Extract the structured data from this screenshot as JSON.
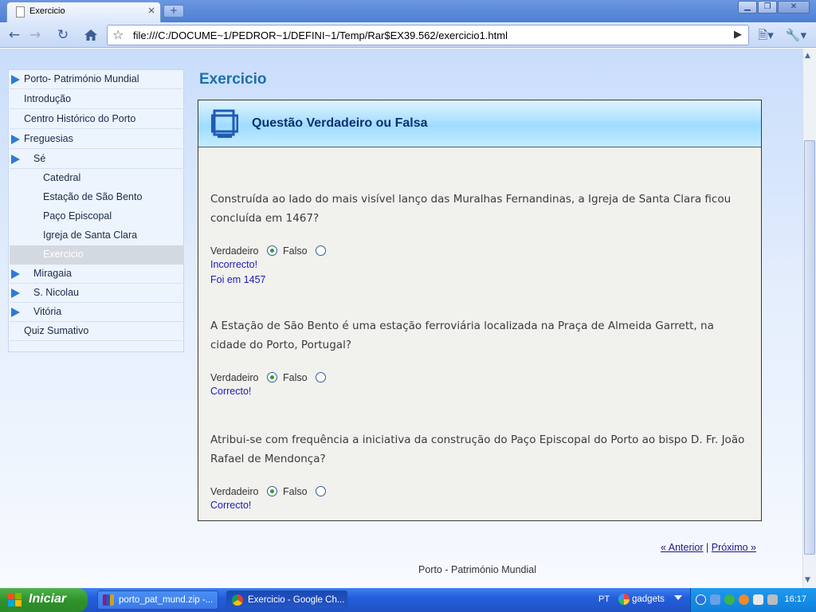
{
  "browser": {
    "tab_title": "Exercicio",
    "tab_close": "×",
    "new_tab": "+",
    "url": "file:///C:/DOCUME~1/PEDROR~1/DEFINI~1/Temp/Rar$EX39.562/exercicio1.html",
    "window_controls": {
      "minimize": "▁",
      "maximize": "❐",
      "close": "✕"
    }
  },
  "sidebar": {
    "items": [
      {
        "label": "Porto- Património Mundial",
        "arrow": true,
        "level": 0
      },
      {
        "label": "Introdução",
        "arrow": false,
        "level": 0
      },
      {
        "label": "Centro Histórico do Porto",
        "arrow": false,
        "level": 0
      },
      {
        "label": "Freguesias",
        "arrow": true,
        "level": 0
      },
      {
        "label": "Sé",
        "arrow": true,
        "level": 1
      },
      {
        "label": "Catedral",
        "arrow": false,
        "level": 2
      },
      {
        "label": "Estação de São Bento",
        "arrow": false,
        "level": 2
      },
      {
        "label": "Paço Episcopal",
        "arrow": false,
        "level": 2
      },
      {
        "label": "Igreja de Santa Clara",
        "arrow": false,
        "level": 2
      },
      {
        "label": "Exercicio",
        "arrow": false,
        "level": 2,
        "active": true
      },
      {
        "label": "Miragaia",
        "arrow": true,
        "level": 1
      },
      {
        "label": "S. Nicolau",
        "arrow": true,
        "level": 1
      },
      {
        "label": "Vitória",
        "arrow": true,
        "level": 1
      },
      {
        "label": "Quiz Sumativo",
        "arrow": false,
        "level": 0
      }
    ]
  },
  "page_title": "Exercicio",
  "exercise": {
    "header_title": "Questão Verdadeiro ou Falsa",
    "questions": [
      {
        "text": "Construída ao lado do mais visível lanço das Muralhas Fernandinas, a Igreja de Santa Clara ficou concluída em 1467?",
        "option_true": "Verdadeiro",
        "option_false": "Falso",
        "selected": "true",
        "feedback": "Incorrecto!",
        "feedback_extra": "Foi em 1457"
      },
      {
        "text": "A Estação de São Bento é uma estação ferroviária localizada na Praça de Almeida Garrett, na cidade do Porto, Portugal?",
        "option_true": "Verdadeiro",
        "option_false": "Falso",
        "selected": "true",
        "feedback": "Correcto!"
      },
      {
        "text": "Atribui-se com frequência a iniciativa da construção do Paço Episcopal do Porto ao bispo D. Fr. João Rafael de Mendonça?",
        "option_true": "Verdadeiro",
        "option_false": "Falso",
        "selected": "true",
        "feedback": "Correcto!"
      }
    ]
  },
  "pager": {
    "previous": "« Anterior",
    "separator": "|",
    "next": "Próximo »"
  },
  "footer": "Porto - Património Mundial",
  "taskbar": {
    "start_label": "Iniciar",
    "tasks": [
      {
        "label": "porto_pat_mund.zip -...",
        "icon": "winrar-icon",
        "active": false
      },
      {
        "label": "Exercicio - Google Ch...",
        "icon": "chrome-icon",
        "active": true
      }
    ],
    "language": "PT",
    "gadgets_label": "gadgets",
    "clock": "16:17"
  },
  "colors": {
    "accent": "#1b6fae",
    "header_title": "#0d2f73",
    "feedback": "#1b1bb8",
    "nav_arrow": "#2c7ad8"
  }
}
